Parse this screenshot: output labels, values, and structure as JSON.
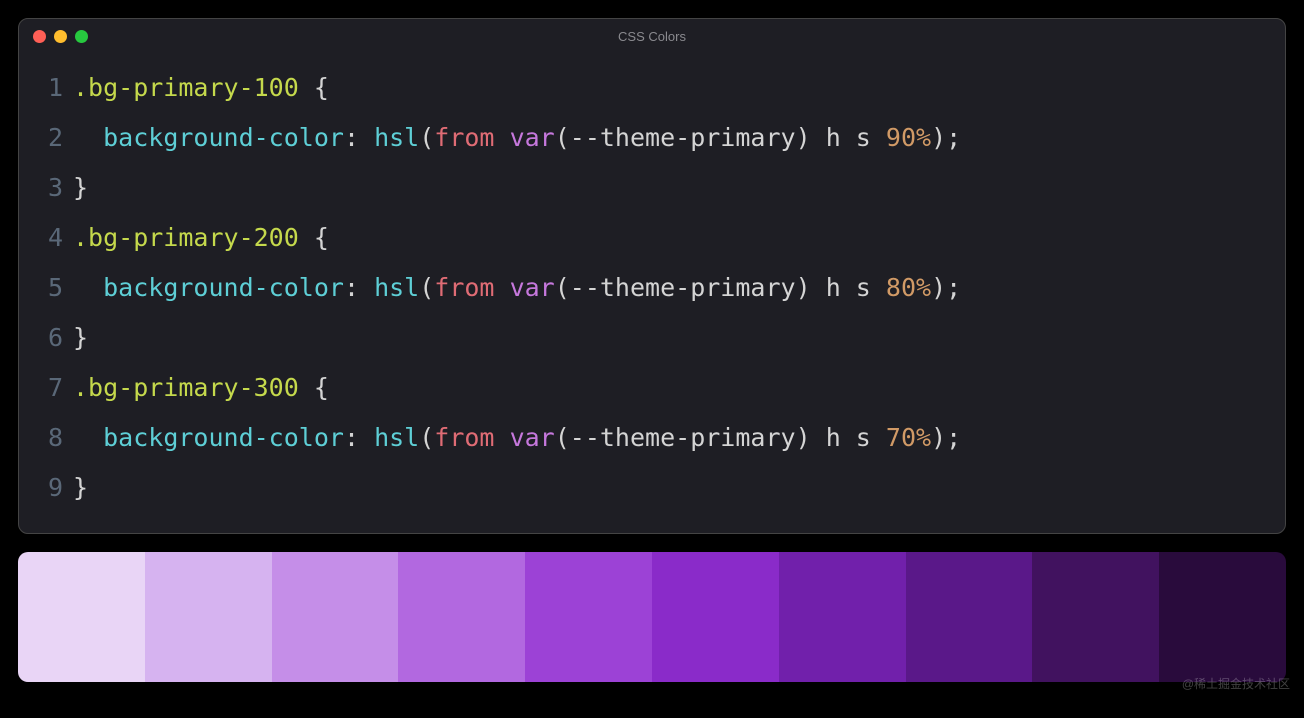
{
  "window": {
    "title": "CSS Colors"
  },
  "traffic_lights": {
    "red": "#ff5f56",
    "yellow": "#ffbd2e",
    "green": "#27c93f"
  },
  "code": {
    "lines": [
      {
        "num": "1",
        "tokens": [
          {
            "t": ".bg-primary-100",
            "c": "tok-selector"
          },
          {
            "t": " ",
            "c": ""
          },
          {
            "t": "{",
            "c": "tok-brace"
          }
        ]
      },
      {
        "num": "2",
        "tokens": [
          {
            "t": "  ",
            "c": ""
          },
          {
            "t": "background-color",
            "c": "tok-prop"
          },
          {
            "t": ":",
            "c": "tok-colon"
          },
          {
            "t": " ",
            "c": ""
          },
          {
            "t": "hsl",
            "c": "tok-func"
          },
          {
            "t": "(",
            "c": "tok-paren"
          },
          {
            "t": "from",
            "c": "tok-from"
          },
          {
            "t": " ",
            "c": ""
          },
          {
            "t": "var",
            "c": "tok-var"
          },
          {
            "t": "(",
            "c": "tok-paren"
          },
          {
            "t": "--theme-primary",
            "c": "tok-varname"
          },
          {
            "t": ")",
            "c": "tok-paren"
          },
          {
            "t": " ",
            "c": ""
          },
          {
            "t": "h s ",
            "c": "tok-id"
          },
          {
            "t": "90%",
            "c": "tok-num"
          },
          {
            "t": ")",
            "c": "tok-paren"
          },
          {
            "t": ";",
            "c": "tok-semi"
          }
        ]
      },
      {
        "num": "3",
        "tokens": [
          {
            "t": "}",
            "c": "tok-brace"
          }
        ]
      },
      {
        "num": "4",
        "tokens": [
          {
            "t": ".bg-primary-200",
            "c": "tok-selector"
          },
          {
            "t": " ",
            "c": ""
          },
          {
            "t": "{",
            "c": "tok-brace"
          }
        ]
      },
      {
        "num": "5",
        "tokens": [
          {
            "t": "  ",
            "c": ""
          },
          {
            "t": "background-color",
            "c": "tok-prop"
          },
          {
            "t": ":",
            "c": "tok-colon"
          },
          {
            "t": " ",
            "c": ""
          },
          {
            "t": "hsl",
            "c": "tok-func"
          },
          {
            "t": "(",
            "c": "tok-paren"
          },
          {
            "t": "from",
            "c": "tok-from"
          },
          {
            "t": " ",
            "c": ""
          },
          {
            "t": "var",
            "c": "tok-var"
          },
          {
            "t": "(",
            "c": "tok-paren"
          },
          {
            "t": "--theme-primary",
            "c": "tok-varname"
          },
          {
            "t": ")",
            "c": "tok-paren"
          },
          {
            "t": " ",
            "c": ""
          },
          {
            "t": "h s ",
            "c": "tok-id"
          },
          {
            "t": "80%",
            "c": "tok-num"
          },
          {
            "t": ")",
            "c": "tok-paren"
          },
          {
            "t": ";",
            "c": "tok-semi"
          }
        ]
      },
      {
        "num": "6",
        "tokens": [
          {
            "t": "}",
            "c": "tok-brace"
          }
        ]
      },
      {
        "num": "7",
        "tokens": [
          {
            "t": ".bg-primary-300",
            "c": "tok-selector"
          },
          {
            "t": " ",
            "c": ""
          },
          {
            "t": "{",
            "c": "tok-brace"
          }
        ]
      },
      {
        "num": "8",
        "tokens": [
          {
            "t": "  ",
            "c": ""
          },
          {
            "t": "background-color",
            "c": "tok-prop"
          },
          {
            "t": ":",
            "c": "tok-colon"
          },
          {
            "t": " ",
            "c": ""
          },
          {
            "t": "hsl",
            "c": "tok-func"
          },
          {
            "t": "(",
            "c": "tok-paren"
          },
          {
            "t": "from",
            "c": "tok-from"
          },
          {
            "t": " ",
            "c": ""
          },
          {
            "t": "var",
            "c": "tok-var"
          },
          {
            "t": "(",
            "c": "tok-paren"
          },
          {
            "t": "--theme-primary",
            "c": "tok-varname"
          },
          {
            "t": ")",
            "c": "tok-paren"
          },
          {
            "t": " ",
            "c": ""
          },
          {
            "t": "h s ",
            "c": "tok-id"
          },
          {
            "t": "70%",
            "c": "tok-num"
          },
          {
            "t": ")",
            "c": "tok-paren"
          },
          {
            "t": ";",
            "c": "tok-semi"
          }
        ]
      },
      {
        "num": "9",
        "tokens": [
          {
            "t": "}",
            "c": "tok-brace"
          }
        ]
      }
    ]
  },
  "swatches": [
    "#e9d5f6",
    "#d6b3f0",
    "#c58ee8",
    "#b268e0",
    "#9c42d6",
    "#8a2bc9",
    "#7120ab",
    "#5a1889",
    "#41125f",
    "#290b3c"
  ],
  "watermark": "@稀土掘金技术社区"
}
